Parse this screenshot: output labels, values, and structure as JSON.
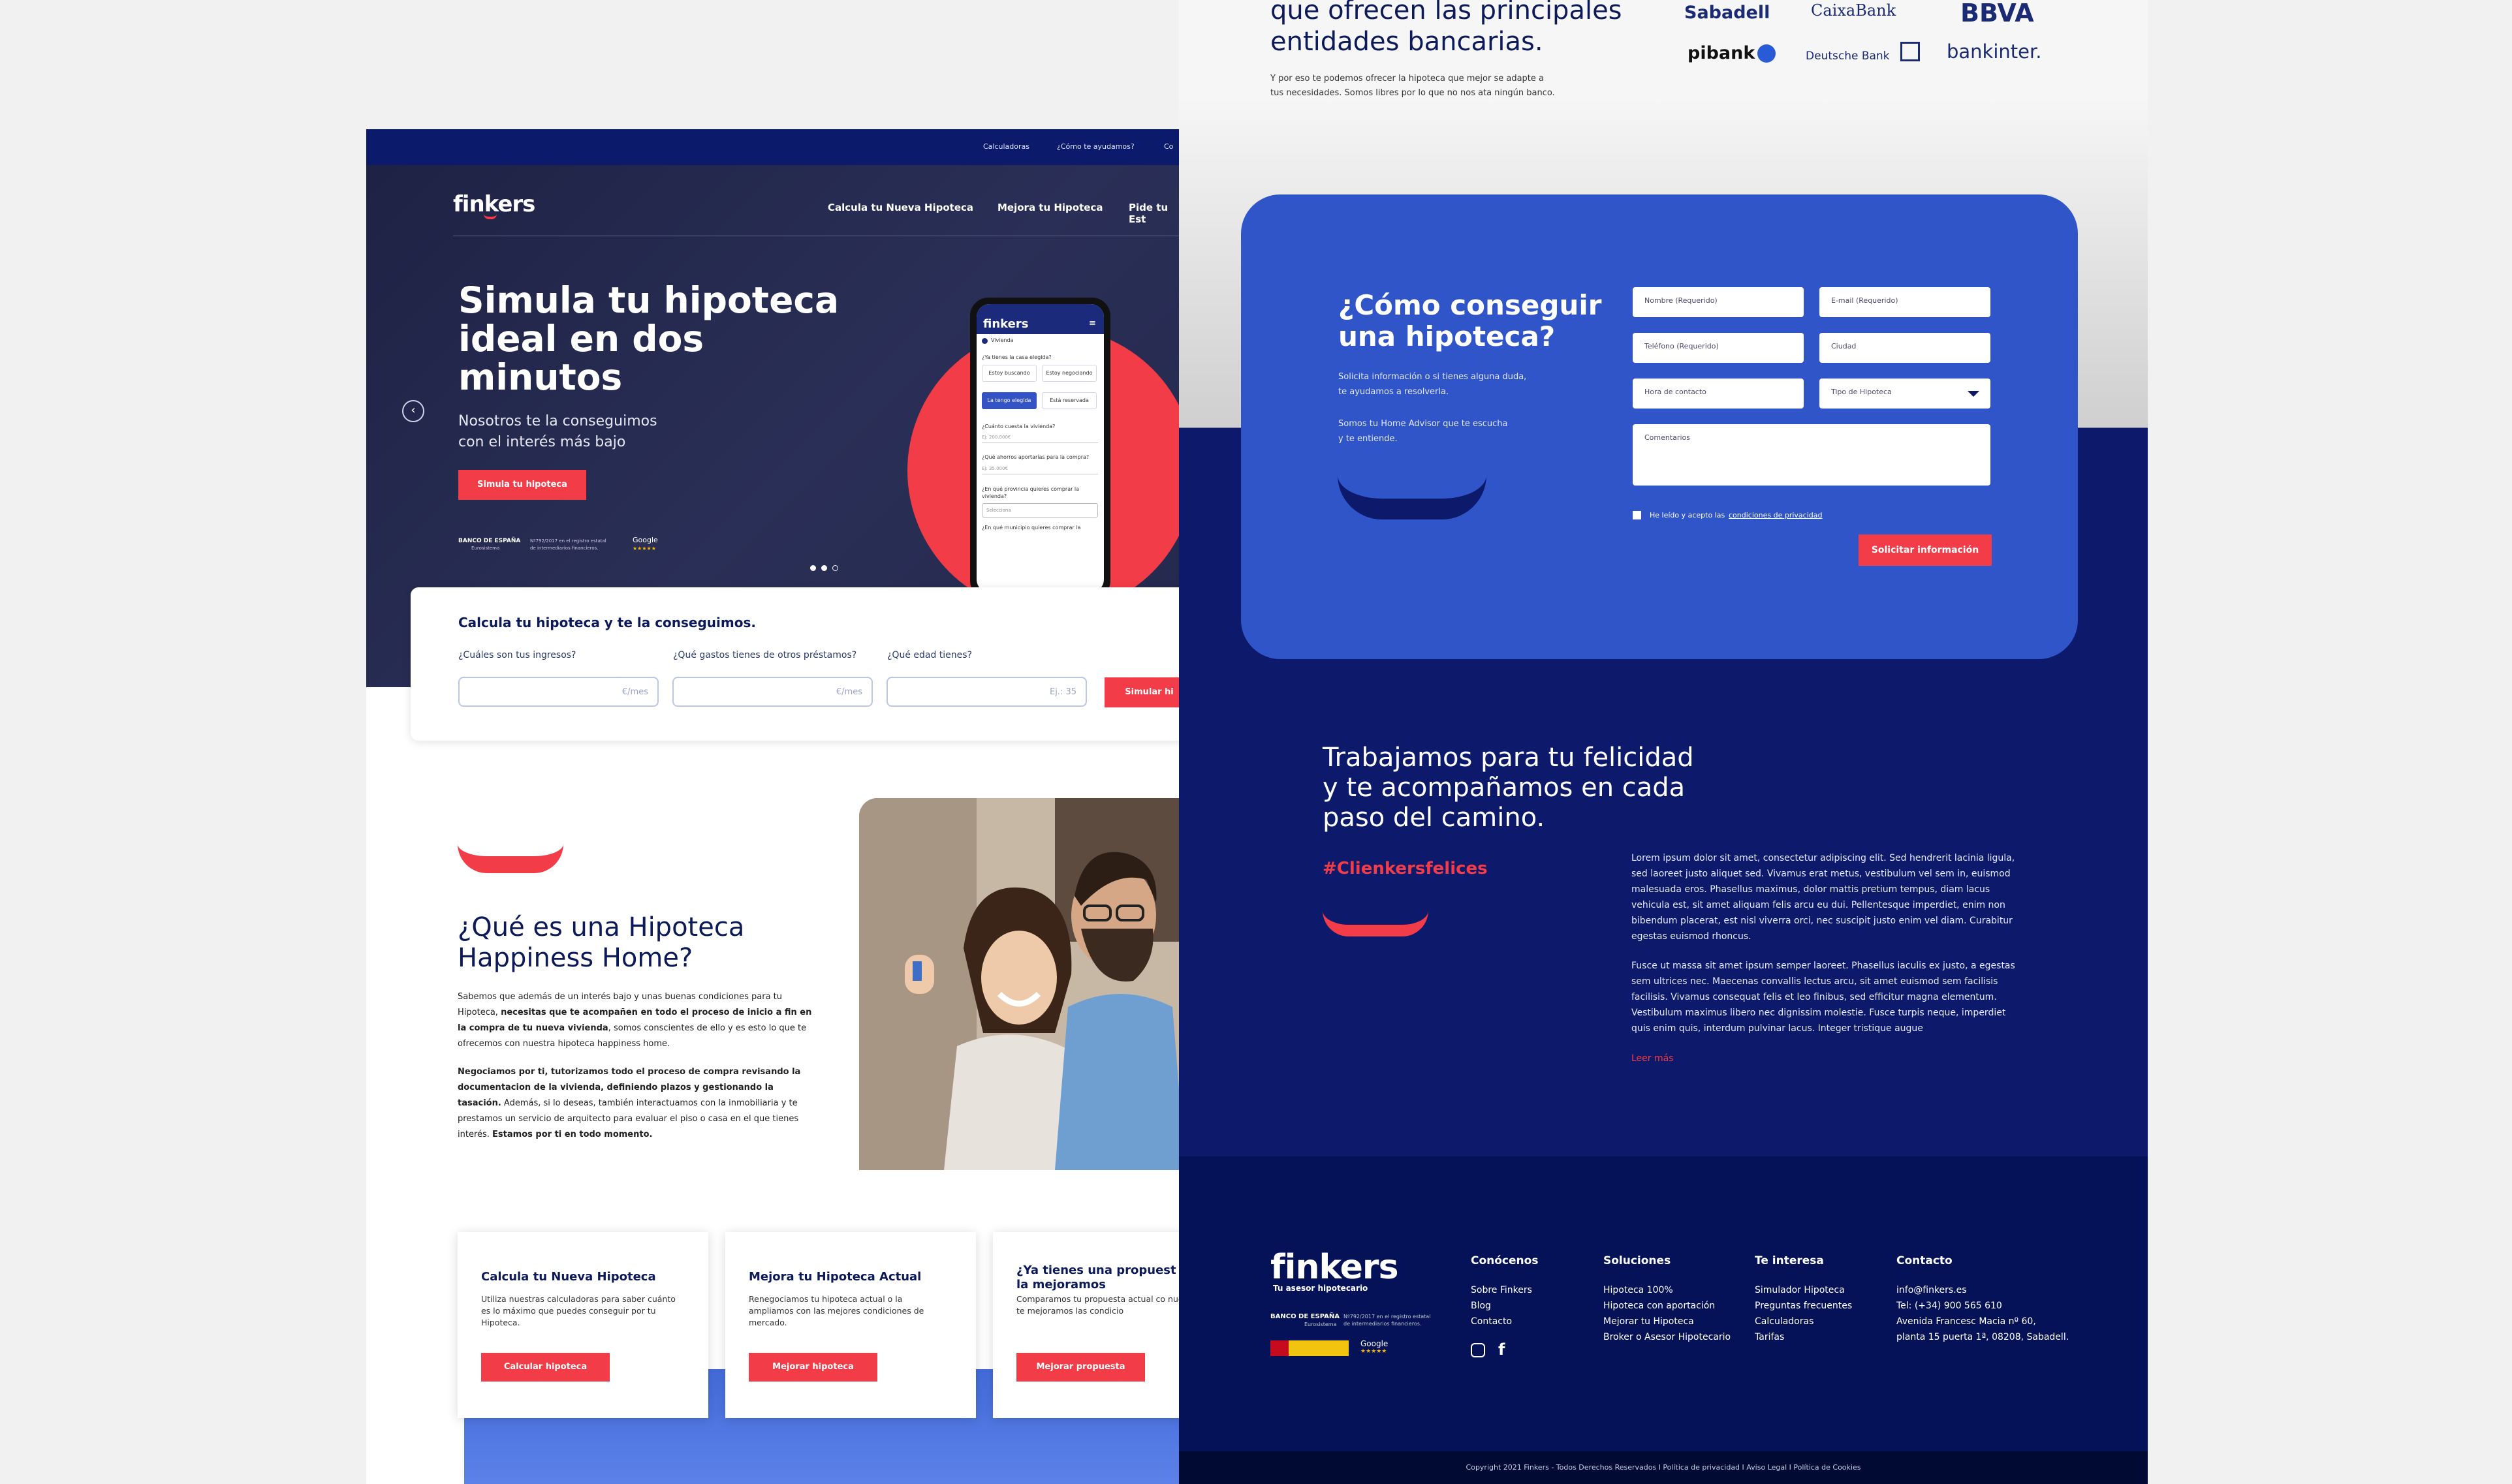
{
  "left": {
    "topnav": [
      "Calculadoras",
      "¿Cómo te ayudamos?",
      "Co"
    ],
    "logo": "finkers",
    "menu": [
      "Calcula tu Nueva Hipoteca",
      "Mejora tu Hipoteca",
      "Pide tu Est"
    ],
    "hero_title": [
      "Simula tu hipoteca",
      "ideal en dos",
      "minutos"
    ],
    "hero_sub": [
      "Nosotros te la conseguimos",
      "con el interés más bajo"
    ],
    "hero_btn": "Simula tu hipoteca",
    "badge_bank": "BANCO DE ESPAÑA",
    "badge_bank_sub": "Eurosistema",
    "badge_reg": [
      "Nº792/2017 en el registro estatal",
      "de intermediarios financieros."
    ],
    "badge_google": "Google",
    "phone": {
      "brand": "finkers",
      "tab": "Vivienda",
      "q1": "¿Ya tienes la casa elegida?",
      "opts": [
        "Estoy buscando",
        "Estoy negociando",
        "La tengo elegida",
        "Está reservada"
      ],
      "q2": "¿Cuánto cuesta la vivienda?",
      "v2": "Ej: 200.000€",
      "q3": "¿Qué ahorros aportarías para la compra?",
      "v3": "Ej: 35.000€",
      "q4": [
        "¿En qué provincia quieres comprar la",
        "vivienda?"
      ],
      "select": "Selecciona",
      "q5": "¿En qué municipio quieres comprar la"
    },
    "calc": {
      "title": "Calcula tu hipoteca y te la conseguimos.",
      "l1": "¿Cuáles son tus ingresos?",
      "p1": "€/mes",
      "l2": "¿Qué gastos tienes de otros préstamos?",
      "p2": "€/mes",
      "l3": "¿Qué edad tienes?",
      "p3": "Ej.: 35",
      "btn": "Simular hi"
    },
    "what": {
      "title": [
        "¿Qué es una Hipoteca",
        "Happiness Home?"
      ],
      "p1a": "Sabemos que además de un interés bajo y unas buenas condiciones para tu Hipoteca, ",
      "p1b": "necesitas que te acompañen en todo el proceso de inicio a fin en la compra de tu nueva vivienda",
      "p1c": ", somos conscientes de ello y es esto lo que te ofrecemos con nuestra hipoteca happiness home.",
      "p2a": "Negociamos por ti, tutorizamos todo el proceso de compra revisando la documentacion de la vivienda, definiendo plazos y gestionando la tasación.",
      "p2b": " Además, si lo deseas, también interactuamos con la inmobiliaria y te prestamos un servicio de arquitecto para evaluar el piso o casa en el que tienes interés. ",
      "p2c": "Estamos por ti en todo momento."
    },
    "cards": [
      {
        "title": "Calcula tu Nueva Hipoteca",
        "text": "Utiliza nuestras calculadoras para saber cuánto es lo máximo que puedes conseguir por tu Hipoteca.",
        "btn": "Calcular hipoteca"
      },
      {
        "title": "Mejora tu Hipoteca Actual",
        "text": "Renegociamos tu hipoteca actual o la ampliamos con las mejores condiciones de mercado.",
        "btn": "Mejorar hipoteca"
      },
      {
        "title": "¿Ya tienes una propuest Te la mejoramos",
        "text": "Comparamos tu propuesta actual co nuestra y te mejoramos las condicio",
        "btn": "Mejorar propuesta"
      }
    ]
  },
  "right": {
    "banks_title": [
      "que ofrecen las principales",
      "entidades bancarias."
    ],
    "banks_text": [
      "Y por eso te podemos ofrecer la hipoteca que mejor se adapte a",
      "tus necesidades. Somos libres por lo que no nos ata ningún banco."
    ],
    "banks": [
      "Sabadell",
      "CaixaBank",
      "BBVA",
      "pibank",
      "Deutsche Bank",
      "bankinter."
    ],
    "form": {
      "title": [
        "¿Cómo conseguir",
        "una hipoteca?"
      ],
      "text1": [
        "Solicita información o si tienes alguna duda,",
        "te ayudamos a resolverla."
      ],
      "text2": [
        "Somos tu Home Advisor que te escucha",
        "y te entiende."
      ],
      "f1": "Nombre (Requerido)",
      "f2": "E-mail (Requerido)",
      "f3": "Teléfono (Requerido)",
      "f4": "Ciudad",
      "f5": "Hora de contacto",
      "f6": "Tipo de Hipoteca",
      "f7": "Comentarios",
      "check": "He leído y acepto las",
      "check_link": "condiciones de privacidad",
      "btn": "Solicitar información"
    },
    "happy": {
      "title": [
        "Trabajamos para tu felicidad",
        "y te acompañamos en cada",
        "paso del camino."
      ],
      "hashtag": "#Clienkersfelices",
      "p1": "Lorem ipsum dolor sit amet, consectetur adipiscing elit. Sed hendrerit lacinia ligula, sed laoreet justo aliquet sed. Vivamus erat metus, vestibulum vel sem in, euismod malesuada eros. Phasellus maximus, dolor mattis pretium tempus, diam lacus vehicula est, sit amet aliquam felis arcu eu dui. Pellentesque imperdiet, enim non bibendum placerat, est nisl viverra orci, nec suscipit justo enim vel diam. Curabitur egestas euismod rhoncus.",
      "p2": "Fusce ut massa sit amet ipsum semper laoreet. Phasellus iaculis ex justo, a egestas sem ultrices nec. Maecenas convallis lectus arcu, sit amet euismod sem facilisis facilisis. Vivamus consequat felis et leo finibus, sed efficitur magna elementum. Vestibulum maximus libero nec dignissim molestie. Fusce turpis neque, imperdiet quis enim quis, interdum pulvinar lacus. Integer tristique augue",
      "more": "Leer más"
    },
    "footer": {
      "logo": "finkers",
      "tagline": "Tu asesor hipotecario",
      "bank": "BANCO DE ESPAÑA",
      "bank_sub": "Eurosistema",
      "reg": [
        "Nº792/2017 en el registro estatal",
        "de intermediarios financieros."
      ],
      "google": "Google",
      "cols": [
        {
          "h": "Conócenos",
          "items": [
            "Sobre Finkers",
            "Blog",
            "Contacto"
          ]
        },
        {
          "h": "Soluciones",
          "items": [
            "Hipoteca 100%",
            "Hipoteca con aportación",
            "Mejorar tu Hipoteca",
            "Broker o Asesor Hipotecario"
          ]
        },
        {
          "h": "Te interesa",
          "items": [
            "Simulador Hipoteca",
            "Preguntas frecuentes",
            "Calculadoras",
            "Tarifas"
          ]
        },
        {
          "h": "Contacto",
          "items": [
            "info@finkers.es",
            "Tel: (+34) 900 565 610",
            "Avenida Francesc Macia nº 60,",
            "planta 15 puerta 1ª, 08208, Sabadell."
          ]
        }
      ],
      "copyright": "Copyright 2021 Finkers - Todos Derechos Reservados I Política de privacidad I Aviso Legal I Política de Cookies"
    }
  },
  "colors": {
    "navy": "#0d1a6b",
    "blue": "#2f55c9",
    "red": "#f23c47",
    "hero": "#24284d"
  }
}
